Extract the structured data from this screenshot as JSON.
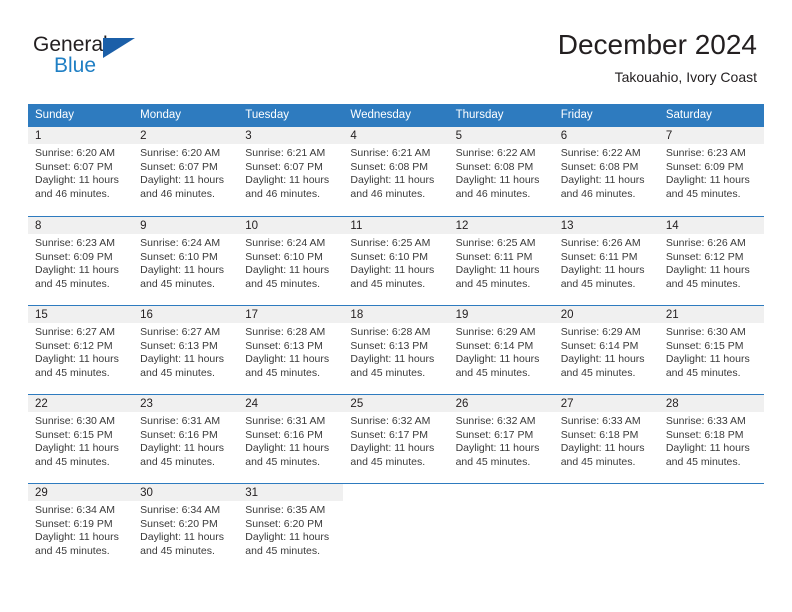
{
  "logo": {
    "word_primary": "General",
    "word_secondary": "Blue",
    "triangle_icon": "triangle-icon"
  },
  "header": {
    "month_title": "December 2024",
    "location": "Takouahio, Ivory Coast"
  },
  "colors": {
    "header_blue": "#2e7bbf",
    "logo_blue": "#1f7fc4",
    "logo_triangle": "#1b5fa8",
    "day_band_gray": "#f0f0f0",
    "text": "#231f20"
  },
  "calendar": {
    "weekdays": [
      "Sunday",
      "Monday",
      "Tuesday",
      "Wednesday",
      "Thursday",
      "Friday",
      "Saturday"
    ],
    "weeks": [
      {
        "days": [
          {
            "number": "1",
            "sunrise": "Sunrise: 6:20 AM",
            "sunset": "Sunset: 6:07 PM",
            "daylight": "Daylight: 11 hours and 46 minutes."
          },
          {
            "number": "2",
            "sunrise": "Sunrise: 6:20 AM",
            "sunset": "Sunset: 6:07 PM",
            "daylight": "Daylight: 11 hours and 46 minutes."
          },
          {
            "number": "3",
            "sunrise": "Sunrise: 6:21 AM",
            "sunset": "Sunset: 6:07 PM",
            "daylight": "Daylight: 11 hours and 46 minutes."
          },
          {
            "number": "4",
            "sunrise": "Sunrise: 6:21 AM",
            "sunset": "Sunset: 6:08 PM",
            "daylight": "Daylight: 11 hours and 46 minutes."
          },
          {
            "number": "5",
            "sunrise": "Sunrise: 6:22 AM",
            "sunset": "Sunset: 6:08 PM",
            "daylight": "Daylight: 11 hours and 46 minutes."
          },
          {
            "number": "6",
            "sunrise": "Sunrise: 6:22 AM",
            "sunset": "Sunset: 6:08 PM",
            "daylight": "Daylight: 11 hours and 46 minutes."
          },
          {
            "number": "7",
            "sunrise": "Sunrise: 6:23 AM",
            "sunset": "Sunset: 6:09 PM",
            "daylight": "Daylight: 11 hours and 45 minutes."
          }
        ]
      },
      {
        "days": [
          {
            "number": "8",
            "sunrise": "Sunrise: 6:23 AM",
            "sunset": "Sunset: 6:09 PM",
            "daylight": "Daylight: 11 hours and 45 minutes."
          },
          {
            "number": "9",
            "sunrise": "Sunrise: 6:24 AM",
            "sunset": "Sunset: 6:10 PM",
            "daylight": "Daylight: 11 hours and 45 minutes."
          },
          {
            "number": "10",
            "sunrise": "Sunrise: 6:24 AM",
            "sunset": "Sunset: 6:10 PM",
            "daylight": "Daylight: 11 hours and 45 minutes."
          },
          {
            "number": "11",
            "sunrise": "Sunrise: 6:25 AM",
            "sunset": "Sunset: 6:10 PM",
            "daylight": "Daylight: 11 hours and 45 minutes."
          },
          {
            "number": "12",
            "sunrise": "Sunrise: 6:25 AM",
            "sunset": "Sunset: 6:11 PM",
            "daylight": "Daylight: 11 hours and 45 minutes."
          },
          {
            "number": "13",
            "sunrise": "Sunrise: 6:26 AM",
            "sunset": "Sunset: 6:11 PM",
            "daylight": "Daylight: 11 hours and 45 minutes."
          },
          {
            "number": "14",
            "sunrise": "Sunrise: 6:26 AM",
            "sunset": "Sunset: 6:12 PM",
            "daylight": "Daylight: 11 hours and 45 minutes."
          }
        ]
      },
      {
        "days": [
          {
            "number": "15",
            "sunrise": "Sunrise: 6:27 AM",
            "sunset": "Sunset: 6:12 PM",
            "daylight": "Daylight: 11 hours and 45 minutes."
          },
          {
            "number": "16",
            "sunrise": "Sunrise: 6:27 AM",
            "sunset": "Sunset: 6:13 PM",
            "daylight": "Daylight: 11 hours and 45 minutes."
          },
          {
            "number": "17",
            "sunrise": "Sunrise: 6:28 AM",
            "sunset": "Sunset: 6:13 PM",
            "daylight": "Daylight: 11 hours and 45 minutes."
          },
          {
            "number": "18",
            "sunrise": "Sunrise: 6:28 AM",
            "sunset": "Sunset: 6:13 PM",
            "daylight": "Daylight: 11 hours and 45 minutes."
          },
          {
            "number": "19",
            "sunrise": "Sunrise: 6:29 AM",
            "sunset": "Sunset: 6:14 PM",
            "daylight": "Daylight: 11 hours and 45 minutes."
          },
          {
            "number": "20",
            "sunrise": "Sunrise: 6:29 AM",
            "sunset": "Sunset: 6:14 PM",
            "daylight": "Daylight: 11 hours and 45 minutes."
          },
          {
            "number": "21",
            "sunrise": "Sunrise: 6:30 AM",
            "sunset": "Sunset: 6:15 PM",
            "daylight": "Daylight: 11 hours and 45 minutes."
          }
        ]
      },
      {
        "days": [
          {
            "number": "22",
            "sunrise": "Sunrise: 6:30 AM",
            "sunset": "Sunset: 6:15 PM",
            "daylight": "Daylight: 11 hours and 45 minutes."
          },
          {
            "number": "23",
            "sunrise": "Sunrise: 6:31 AM",
            "sunset": "Sunset: 6:16 PM",
            "daylight": "Daylight: 11 hours and 45 minutes."
          },
          {
            "number": "24",
            "sunrise": "Sunrise: 6:31 AM",
            "sunset": "Sunset: 6:16 PM",
            "daylight": "Daylight: 11 hours and 45 minutes."
          },
          {
            "number": "25",
            "sunrise": "Sunrise: 6:32 AM",
            "sunset": "Sunset: 6:17 PM",
            "daylight": "Daylight: 11 hours and 45 minutes."
          },
          {
            "number": "26",
            "sunrise": "Sunrise: 6:32 AM",
            "sunset": "Sunset: 6:17 PM",
            "daylight": "Daylight: 11 hours and 45 minutes."
          },
          {
            "number": "27",
            "sunrise": "Sunrise: 6:33 AM",
            "sunset": "Sunset: 6:18 PM",
            "daylight": "Daylight: 11 hours and 45 minutes."
          },
          {
            "number": "28",
            "sunrise": "Sunrise: 6:33 AM",
            "sunset": "Sunset: 6:18 PM",
            "daylight": "Daylight: 11 hours and 45 minutes."
          }
        ]
      },
      {
        "days": [
          {
            "number": "29",
            "sunrise": "Sunrise: 6:34 AM",
            "sunset": "Sunset: 6:19 PM",
            "daylight": "Daylight: 11 hours and 45 minutes."
          },
          {
            "number": "30",
            "sunrise": "Sunrise: 6:34 AM",
            "sunset": "Sunset: 6:20 PM",
            "daylight": "Daylight: 11 hours and 45 minutes."
          },
          {
            "number": "31",
            "sunrise": "Sunrise: 6:35 AM",
            "sunset": "Sunset: 6:20 PM",
            "daylight": "Daylight: 11 hours and 45 minutes."
          },
          {
            "number": "",
            "sunrise": "",
            "sunset": "",
            "daylight": ""
          },
          {
            "number": "",
            "sunrise": "",
            "sunset": "",
            "daylight": ""
          },
          {
            "number": "",
            "sunrise": "",
            "sunset": "",
            "daylight": ""
          },
          {
            "number": "",
            "sunrise": "",
            "sunset": "",
            "daylight": ""
          }
        ]
      }
    ]
  }
}
